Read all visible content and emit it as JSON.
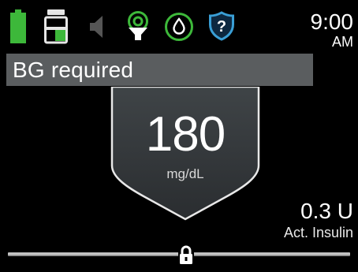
{
  "status_bar": {
    "icons": [
      "battery-icon",
      "reservoir-icon",
      "speaker-icon",
      "sensor-icon",
      "droplet-icon",
      "help-icon"
    ],
    "clock_time": "9:00",
    "clock_ampm": "AM"
  },
  "banner": {
    "text": "BG required"
  },
  "glucose": {
    "value": "180",
    "units": "mg/dL"
  },
  "active_insulin": {
    "value": "0.3 U",
    "label": "Act. Insulin"
  },
  "colors": {
    "battery": "#3db83a",
    "reservoir_fill": "#3db83a",
    "sensor": "#3db83a",
    "droplet_ring": "#3db83a",
    "help_shield": "#3a9fd6",
    "banner_bg": "#5a5d5f"
  }
}
